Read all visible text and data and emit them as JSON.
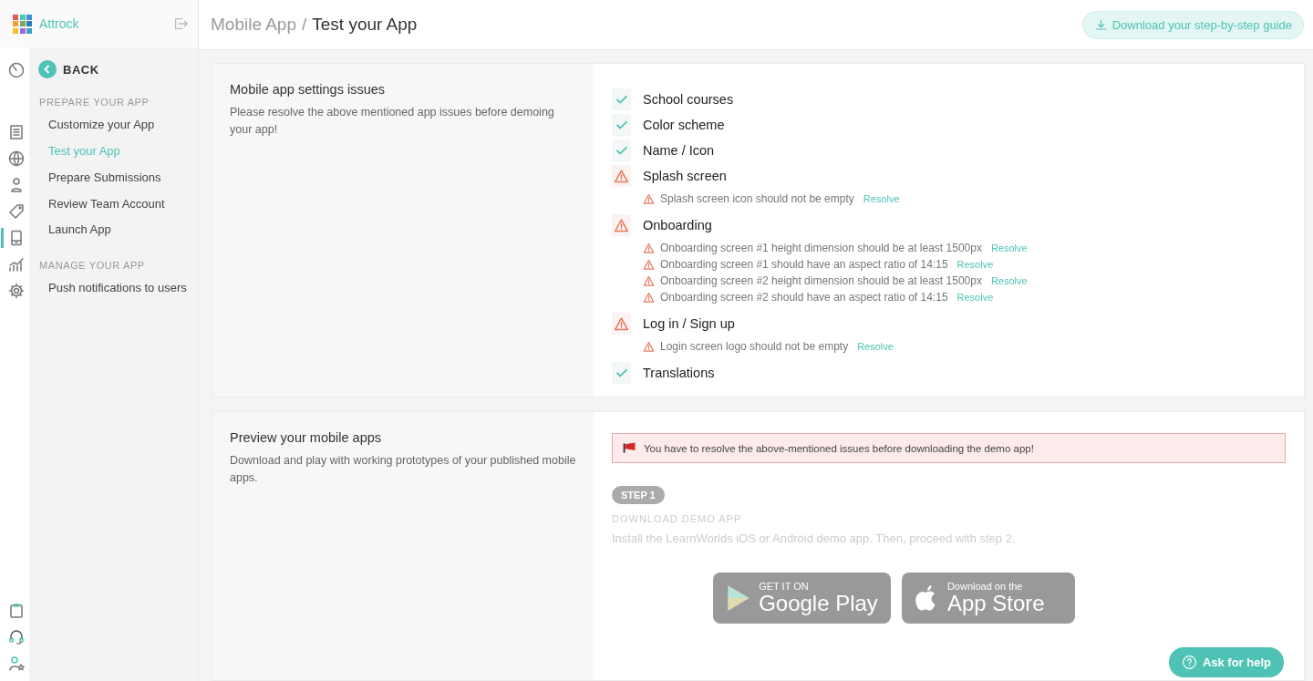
{
  "brand": {
    "name": "Attrock"
  },
  "rail": {
    "top": [
      {
        "selected": false
      }
    ],
    "middle": [
      {
        "selected": false
      },
      {
        "selected": false
      },
      {
        "selected": false
      },
      {
        "selected": false
      },
      {
        "selected": true
      },
      {
        "selected": false
      },
      {
        "selected": false
      }
    ],
    "bottom": [
      {
        "selected": false
      },
      {
        "selected": false
      },
      {
        "selected": false
      }
    ]
  },
  "sidebar": {
    "back": "BACK",
    "sections": [
      {
        "title": "PREPARE YOUR APP",
        "items": [
          {
            "label": "Customize your App",
            "selected": false
          },
          {
            "label": "Test your App",
            "selected": true
          },
          {
            "label": "Prepare Submissions",
            "selected": false
          },
          {
            "label": "Review Team Account",
            "selected": false
          },
          {
            "label": "Launch App",
            "selected": false
          }
        ]
      },
      {
        "title": "MANAGE YOUR APP",
        "items": [
          {
            "label": "Push notifications to users",
            "selected": false
          }
        ]
      }
    ]
  },
  "header": {
    "breadcrumb": "Mobile App",
    "separator": "/",
    "title": "Test your App",
    "guide_button": "Download your step-by-step guide"
  },
  "settings_issues": {
    "title": "Mobile app settings issues",
    "description": "Please resolve the above mentioned app issues before demoing your app!",
    "checks": [
      {
        "label": "School courses",
        "kind": "ok"
      },
      {
        "label": "Color scheme",
        "kind": "ok"
      },
      {
        "label": "Name / Icon",
        "kind": "ok"
      },
      {
        "label": "Splash screen",
        "kind": "warning",
        "issues": [
          {
            "text": "Splash screen icon should not be empty",
            "action": "Resolve"
          }
        ]
      },
      {
        "label": "Onboarding",
        "kind": "warning",
        "issues": [
          {
            "text": "Onboarding screen #1 height dimension should be at least 1500px",
            "action": "Resolve"
          },
          {
            "text": "Onboarding screen #1 should have an aspect ratio of 14:15",
            "action": "Resolve"
          },
          {
            "text": "Onboarding screen #2 height dimension should be at least 1500px",
            "action": "Resolve"
          },
          {
            "text": "Onboarding screen #2 should have an aspect ratio of 14:15",
            "action": "Resolve"
          }
        ]
      },
      {
        "label": "Log in / Sign up",
        "kind": "warning",
        "issues": [
          {
            "text": "Login screen logo should not be empty",
            "action": "Resolve"
          }
        ]
      },
      {
        "label": "Translations",
        "kind": "ok"
      }
    ]
  },
  "preview": {
    "title": "Preview your mobile apps",
    "description": "Download and play with working prototypes of your published mobile apps.",
    "alert": "You have to resolve the above-mentioned issues before downloading the demo app!",
    "step": {
      "badge": "STEP 1",
      "title": "DOWNLOAD DEMO APP",
      "text": "Install the LearnWorlds iOS or Android demo app. Then, proceed with step 2.",
      "disabled": true
    },
    "stores": [
      {
        "kind": "google",
        "small": "GET IT ON",
        "big": "Google Play"
      },
      {
        "kind": "apple",
        "small": "Download on the",
        "big": "App Store"
      }
    ]
  },
  "help_button": "Ask for help"
}
